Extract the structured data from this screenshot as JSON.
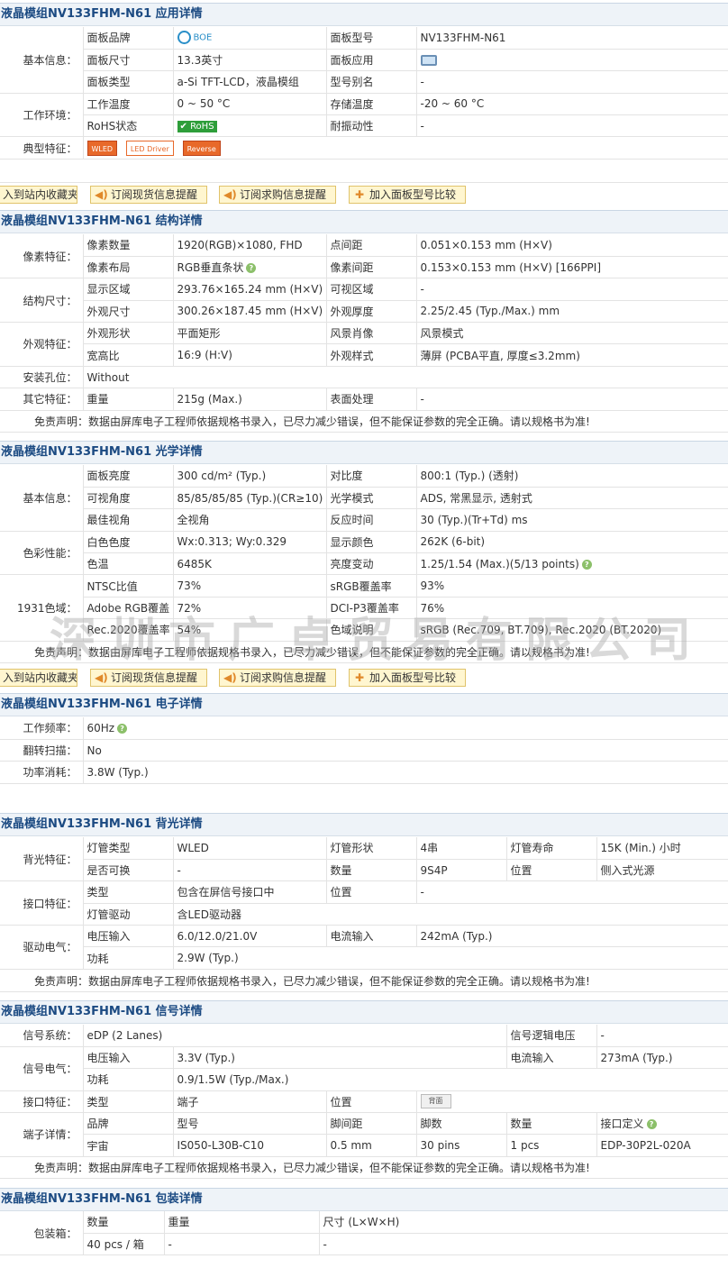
{
  "s1": {
    "title": "液晶模组NV133FHM-N61 应用详情",
    "g_basic": "基本信息：",
    "brand_k": "面板品牌",
    "brand_logo": "BOE",
    "model_k": "面板型号",
    "model_v": "NV133FHM-N61",
    "size_k": "面板尺寸",
    "size_v": "13.3英寸",
    "app_k": "面板应用",
    "type_k": "面板类型",
    "type_v": "a-Si TFT-LCD，液晶模组",
    "alias_k": "型号别名",
    "alias_v": "-",
    "g_env": "工作环境：",
    "wt_k": "工作温度",
    "wt_v": "0 ~ 50 °C",
    "st_k": "存储温度",
    "st_v": "-20 ~ 60 °C",
    "rohs_k": "RoHS状态",
    "rohs_v": "RoHS",
    "vib_k": "耐振动性",
    "vib_v": "-",
    "g_feat": "典型特征：",
    "feat1": "WLED",
    "feat2": "LED Driver",
    "feat3": "Reverse"
  },
  "bar": {
    "b1": "入到站内收藏夹",
    "b2": "订阅现货信息提醒",
    "b3": "订阅求购信息提醒",
    "b4": "加入面板型号比较"
  },
  "s2": {
    "title": "液晶模组NV133FHM-N61 结构详情",
    "g1": "像素特征：",
    "r1": [
      "像素数量",
      "1920(RGB)×1080, FHD",
      "点间距",
      "0.051×0.153 mm (H×V)"
    ],
    "r2": [
      "像素布局",
      "RGB垂直条状",
      "像素间距",
      "0.153×0.153 mm (H×V)  [166PPI]"
    ],
    "g2": "结构尺寸：",
    "r3": [
      "显示区域",
      "293.76×165.24 mm (H×V)",
      "可视区域",
      "-"
    ],
    "r4": [
      "外观尺寸",
      "300.26×187.45 mm (H×V)",
      "外观厚度",
      "2.25/2.45 (Typ./Max.) mm"
    ],
    "g3": "外观特征：",
    "r5": [
      "外观形状",
      "平面矩形",
      "风景肖像",
      "风景模式"
    ],
    "r6": [
      "宽高比",
      "16:9 (H:V)",
      "外观样式",
      "薄屏 (PCBA平直, 厚度≤3.2mm)"
    ],
    "g4": "安装孔位：",
    "holes": "Without",
    "g5": "其它特征：",
    "r7": [
      "重量",
      "215g (Max.)",
      "表面处理",
      "-"
    ],
    "disc": "免责声明：数据由屏库电子工程师依据规格书录入，已尽力减少错误，但不能保证参数的完全正确。请以规格书为准!"
  },
  "s3": {
    "title": "液晶模组NV133FHM-N61 光学详情",
    "g1": "基本信息：",
    "r1": [
      "面板亮度",
      "300 cd/m² (Typ.)",
      "对比度",
      "800:1 (Typ.) (透射)"
    ],
    "r2": [
      "可视角度",
      "85/85/85/85 (Typ.)(CR≥10)",
      "光学模式",
      "ADS, 常黑显示, 透射式"
    ],
    "r3": [
      "最佳视角",
      "全视角",
      "反应时间",
      "30 (Typ.)(Tr+Td) ms"
    ],
    "g2": "色彩性能：",
    "r4": [
      "白色色度",
      "Wx:0.313; Wy:0.329",
      "显示颜色",
      "262K (6-bit)"
    ],
    "r5": [
      "色温",
      "6485K",
      "亮度变动",
      "1.25/1.54 (Max.)(5/13 points)"
    ],
    "g3": "1931色域：",
    "r6": [
      "NTSC比值",
      "73%",
      "sRGB覆盖率",
      "93%"
    ],
    "r7": [
      "Adobe RGB覆盖",
      "72%",
      "DCI-P3覆盖率",
      "76%"
    ],
    "r8": [
      "Rec.2020覆盖率",
      "54%",
      "色域说明",
      "sRGB (Rec.709, BT.709), Rec.2020 (BT.2020)"
    ],
    "disc": "免责声明：数据由屏库电子工程师依据规格书录入，已尽力减少错误，但不能保证参数的完全正确。请以规格书为准!",
    "watermark": "深圳市广卓贸易有限公司"
  },
  "s4": {
    "title": "液晶模组NV133FHM-N61 电子详情",
    "k1": "工作频率：",
    "v1": "60Hz",
    "k2": "翻转扫描：",
    "v2": "No",
    "k3": "功率消耗：",
    "v3": "3.8W (Typ.)"
  },
  "s5": {
    "title": "液晶模组NV133FHM-N61 背光详情",
    "g1": "背光特征：",
    "r1": [
      "灯管类型",
      "WLED",
      "灯管形状",
      "4串",
      "灯管寿命",
      "15K (Min.) 小时"
    ],
    "r2": [
      "是否可换",
      "-",
      "数量",
      "9S4P",
      "位置",
      "侧入式光源"
    ],
    "g2": "接口特征：",
    "r3": [
      "类型",
      "包含在屏信号接口中",
      "位置",
      "-"
    ],
    "r4": [
      "灯管驱动",
      "含LED驱动器"
    ],
    "g3": "驱动电气：",
    "r5": [
      "电压输入",
      "6.0/12.0/21.0V",
      "电流输入",
      "242mA (Typ.)"
    ],
    "r6": [
      "功耗",
      "2.9W (Typ.)"
    ],
    "disc": "免责声明：数据由屏库电子工程师依据规格书录入，已尽力减少错误，但不能保证参数的完全正确。请以规格书为准!"
  },
  "s6": {
    "title": "液晶模组NV133FHM-N61 信号详情",
    "g1": "信号系统：",
    "sys": "eDP (2 Lanes)",
    "logic_k": "信号逻辑电压",
    "logic_v": "-",
    "g2": "信号电气：",
    "r1": [
      "电压输入",
      "3.3V (Typ.)",
      "电流输入",
      "273mA (Typ.)"
    ],
    "r2": [
      "功耗",
      "0.9/1.5W (Typ./Max.)"
    ],
    "g3": "接口特征：",
    "r3": [
      "类型",
      "端子",
      "位置",
      "背面"
    ],
    "g4": "端子详情：",
    "h": [
      "品牌",
      "型号",
      "脚间距",
      "脚数",
      "数量",
      "接口定义"
    ],
    "d": [
      "宇宙",
      "IS050-L30B-C10",
      "0.5 mm",
      "30 pins",
      "1 pcs",
      "EDP-30P2L-020A"
    ],
    "disc": "免责声明：数据由屏库电子工程师依据规格书录入，已尽力减少错误，但不能保证参数的完全正确。请以规格书为准!"
  },
  "s7": {
    "title": "液晶模组NV133FHM-N61 包装详情",
    "g1": "包装箱：",
    "h": [
      "数量",
      "重量",
      "尺寸 (L×W×H)"
    ],
    "d": [
      "40 pcs / 箱",
      "-",
      "-"
    ]
  }
}
